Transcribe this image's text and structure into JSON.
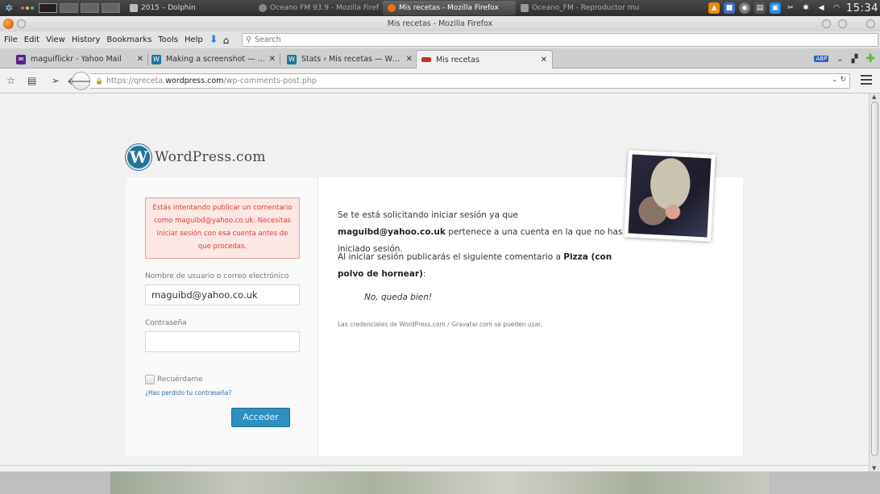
{
  "panel": {
    "tasks": [
      {
        "label": "2015 – Dolphin",
        "active": false
      },
      {
        "label": "Oceano FM 93.9 - Mozilla Firef",
        "active": false
      },
      {
        "label": "Mis recetas - Mozilla Firefox",
        "active": true
      },
      {
        "label": "Oceano_FM - Reproductor mu",
        "active": false
      }
    ],
    "clock": "15:34"
  },
  "window": {
    "title": "Mis recetas - Mozilla Firefox"
  },
  "menu": {
    "items": [
      "File",
      "Edit",
      "View",
      "History",
      "Bookmarks",
      "Tools",
      "Help"
    ],
    "search_placeholder": "Search"
  },
  "tabs": [
    {
      "label": "maguiflickr - Yahoo Mail",
      "favicon": "yahoo-mail-icon"
    },
    {
      "label": "Making a screenshot — …",
      "favicon": "wordpress-icon"
    },
    {
      "label": "Stats ‹ Mis recetas — W…",
      "favicon": "wordpress-icon"
    },
    {
      "label": "Mis recetas",
      "favicon": "mis-recetas-icon",
      "selected": true
    }
  ],
  "url": {
    "scheme": "https://",
    "sub": "qreceta.",
    "host": "wordpress.com",
    "path": "/wp-comments-post.php"
  },
  "logo": {
    "mark": "W",
    "name": "WordPress.com"
  },
  "login": {
    "error": "Estás intentando publicar un comentario como maguibd@yahoo.co.uk. Necesitas iniciar sesión con esa cuenta antes de que procedas.",
    "username_label": "Nombre de usuario o correo electrónico",
    "username_value": "maguibd@yahoo.co.uk",
    "password_label": "Contraseña",
    "password_value": "",
    "remember_label": "Recuérdame",
    "lost_password": "¿Has perdido tu contraseña?",
    "submit": "Acceder"
  },
  "message": {
    "p1_before": "Se te está solicitando iniciar sesión ya que ",
    "p1_email": "maguibd@yahoo.co.uk",
    "p1_after": " pertenece a una cuenta en la que no has iniciado sesión.",
    "p2_before": "Al iniciar sesión publicarás el siguiente comentario a ",
    "p2_post": "Pizza (con polvo de hornear)",
    "p2_after": ":",
    "quote": "No, queda bien!",
    "note": "Las credenciales de WordPress.com / Gravatar.com se pueden usar."
  },
  "colors": {
    "wp_blue": "#21759b",
    "button": "#2e8fc3",
    "error_bg": "#fde7e5",
    "error_text": "#d8412f",
    "link": "#2e6fa8"
  }
}
